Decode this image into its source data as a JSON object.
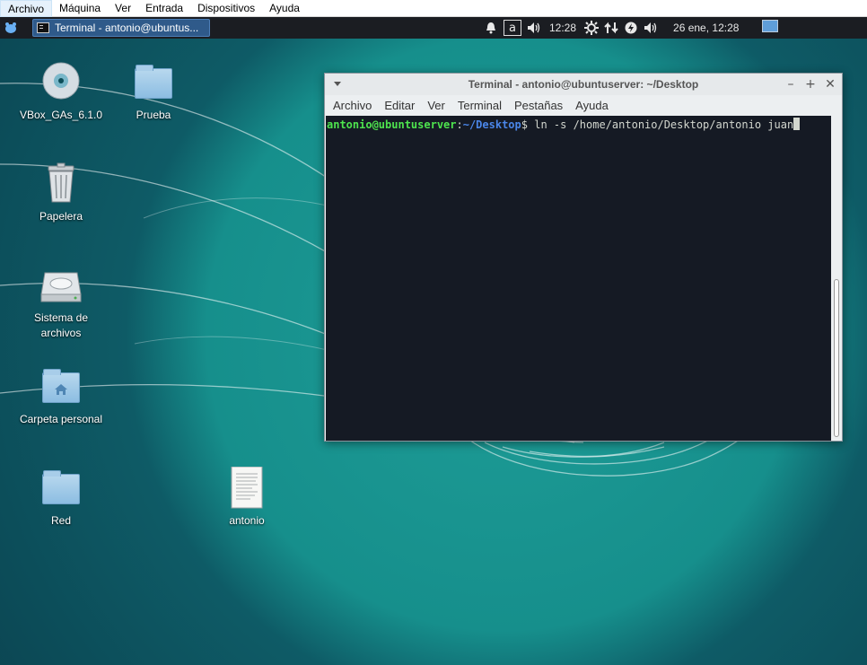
{
  "vbox_menu": [
    "Archivo",
    "Máquina",
    "Ver",
    "Entrada",
    "Dispositivos",
    "Ayuda"
  ],
  "panel": {
    "task_title": "Terminal - antonio@ubuntus...",
    "kb_indicator": "a",
    "time1": "12:28",
    "date_time": "26 ene, 12:28",
    "tray_icons": [
      "bell-icon",
      "volume-icon",
      "gear-icon",
      "network-icon",
      "power-icon",
      "volume-icon"
    ]
  },
  "desktop_icons": [
    {
      "label": "VBox_GAs_6.1.0",
      "icon": "cd-icon"
    },
    {
      "label": "Prueba",
      "icon": "folder-icon"
    },
    {
      "label": "Papelera",
      "icon": "trash-icon"
    },
    {
      "label": "Sistema de archivos",
      "icon": "drive-icon"
    },
    {
      "label": "Carpeta personal",
      "icon": "home-folder-icon"
    },
    {
      "label": "Red",
      "icon": "folder-icon"
    },
    {
      "label": "antonio",
      "icon": "document-icon"
    }
  ],
  "terminal": {
    "title": "Terminal - antonio@ubuntuserver: ~/Desktop",
    "menu": [
      "Archivo",
      "Editar",
      "Ver",
      "Terminal",
      "Pestañas",
      "Ayuda"
    ],
    "prompt_user": "antonio@ubuntuserver",
    "prompt_sep": ":",
    "prompt_path": "~/Desktop",
    "prompt_end": "$ ",
    "command": "ln -s /home/antonio/Desktop/antonio juan"
  }
}
